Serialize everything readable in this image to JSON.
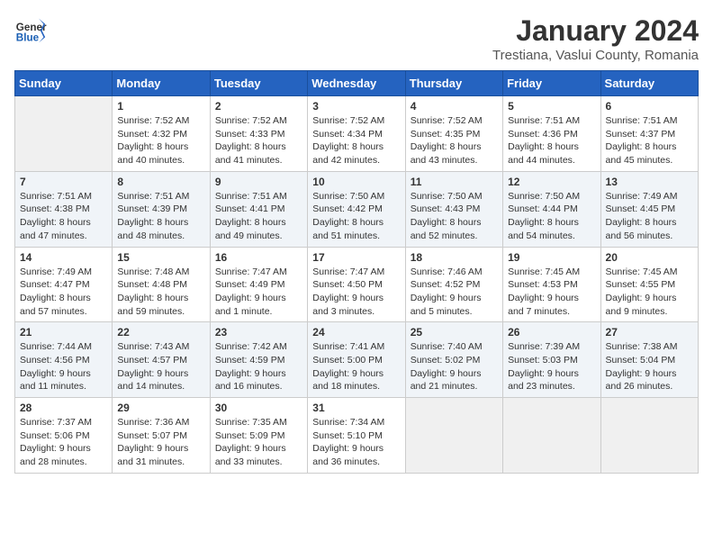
{
  "header": {
    "logo_general": "General",
    "logo_blue": "Blue",
    "month_year": "January 2024",
    "location": "Trestiana, Vaslui County, Romania"
  },
  "days_of_week": [
    "Sunday",
    "Monday",
    "Tuesday",
    "Wednesday",
    "Thursday",
    "Friday",
    "Saturday"
  ],
  "weeks": [
    [
      {
        "day": "",
        "sunrise": "",
        "sunset": "",
        "daylight": ""
      },
      {
        "day": "1",
        "sunrise": "7:52 AM",
        "sunset": "4:32 PM",
        "daylight": "8 hours and 40 minutes."
      },
      {
        "day": "2",
        "sunrise": "7:52 AM",
        "sunset": "4:33 PM",
        "daylight": "8 hours and 41 minutes."
      },
      {
        "day": "3",
        "sunrise": "7:52 AM",
        "sunset": "4:34 PM",
        "daylight": "8 hours and 42 minutes."
      },
      {
        "day": "4",
        "sunrise": "7:52 AM",
        "sunset": "4:35 PM",
        "daylight": "8 hours and 43 minutes."
      },
      {
        "day": "5",
        "sunrise": "7:51 AM",
        "sunset": "4:36 PM",
        "daylight": "8 hours and 44 minutes."
      },
      {
        "day": "6",
        "sunrise": "7:51 AM",
        "sunset": "4:37 PM",
        "daylight": "8 hours and 45 minutes."
      }
    ],
    [
      {
        "day": "7",
        "sunrise": "7:51 AM",
        "sunset": "4:38 PM",
        "daylight": "8 hours and 47 minutes."
      },
      {
        "day": "8",
        "sunrise": "7:51 AM",
        "sunset": "4:39 PM",
        "daylight": "8 hours and 48 minutes."
      },
      {
        "day": "9",
        "sunrise": "7:51 AM",
        "sunset": "4:41 PM",
        "daylight": "8 hours and 49 minutes."
      },
      {
        "day": "10",
        "sunrise": "7:50 AM",
        "sunset": "4:42 PM",
        "daylight": "8 hours and 51 minutes."
      },
      {
        "day": "11",
        "sunrise": "7:50 AM",
        "sunset": "4:43 PM",
        "daylight": "8 hours and 52 minutes."
      },
      {
        "day": "12",
        "sunrise": "7:50 AM",
        "sunset": "4:44 PM",
        "daylight": "8 hours and 54 minutes."
      },
      {
        "day": "13",
        "sunrise": "7:49 AM",
        "sunset": "4:45 PM",
        "daylight": "8 hours and 56 minutes."
      }
    ],
    [
      {
        "day": "14",
        "sunrise": "7:49 AM",
        "sunset": "4:47 PM",
        "daylight": "8 hours and 57 minutes."
      },
      {
        "day": "15",
        "sunrise": "7:48 AM",
        "sunset": "4:48 PM",
        "daylight": "8 hours and 59 minutes."
      },
      {
        "day": "16",
        "sunrise": "7:47 AM",
        "sunset": "4:49 PM",
        "daylight": "9 hours and 1 minute."
      },
      {
        "day": "17",
        "sunrise": "7:47 AM",
        "sunset": "4:50 PM",
        "daylight": "9 hours and 3 minutes."
      },
      {
        "day": "18",
        "sunrise": "7:46 AM",
        "sunset": "4:52 PM",
        "daylight": "9 hours and 5 minutes."
      },
      {
        "day": "19",
        "sunrise": "7:45 AM",
        "sunset": "4:53 PM",
        "daylight": "9 hours and 7 minutes."
      },
      {
        "day": "20",
        "sunrise": "7:45 AM",
        "sunset": "4:55 PM",
        "daylight": "9 hours and 9 minutes."
      }
    ],
    [
      {
        "day": "21",
        "sunrise": "7:44 AM",
        "sunset": "4:56 PM",
        "daylight": "9 hours and 11 minutes."
      },
      {
        "day": "22",
        "sunrise": "7:43 AM",
        "sunset": "4:57 PM",
        "daylight": "9 hours and 14 minutes."
      },
      {
        "day": "23",
        "sunrise": "7:42 AM",
        "sunset": "4:59 PM",
        "daylight": "9 hours and 16 minutes."
      },
      {
        "day": "24",
        "sunrise": "7:41 AM",
        "sunset": "5:00 PM",
        "daylight": "9 hours and 18 minutes."
      },
      {
        "day": "25",
        "sunrise": "7:40 AM",
        "sunset": "5:02 PM",
        "daylight": "9 hours and 21 minutes."
      },
      {
        "day": "26",
        "sunrise": "7:39 AM",
        "sunset": "5:03 PM",
        "daylight": "9 hours and 23 minutes."
      },
      {
        "day": "27",
        "sunrise": "7:38 AM",
        "sunset": "5:04 PM",
        "daylight": "9 hours and 26 minutes."
      }
    ],
    [
      {
        "day": "28",
        "sunrise": "7:37 AM",
        "sunset": "5:06 PM",
        "daylight": "9 hours and 28 minutes."
      },
      {
        "day": "29",
        "sunrise": "7:36 AM",
        "sunset": "5:07 PM",
        "daylight": "9 hours and 31 minutes."
      },
      {
        "day": "30",
        "sunrise": "7:35 AM",
        "sunset": "5:09 PM",
        "daylight": "9 hours and 33 minutes."
      },
      {
        "day": "31",
        "sunrise": "7:34 AM",
        "sunset": "5:10 PM",
        "daylight": "9 hours and 36 minutes."
      },
      {
        "day": "",
        "sunrise": "",
        "sunset": "",
        "daylight": ""
      },
      {
        "day": "",
        "sunrise": "",
        "sunset": "",
        "daylight": ""
      },
      {
        "day": "",
        "sunrise": "",
        "sunset": "",
        "daylight": ""
      }
    ]
  ]
}
